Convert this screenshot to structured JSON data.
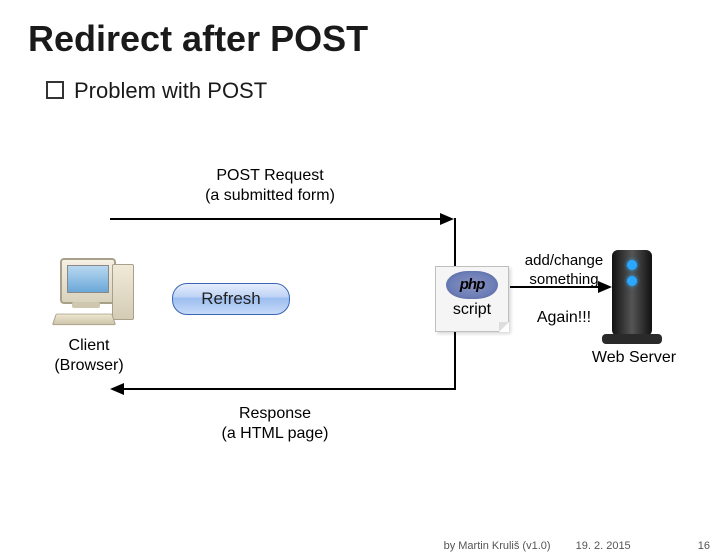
{
  "title": "Redirect after POST",
  "subtitle": "Problem with POST",
  "labels": {
    "post_request_line1": "POST Request",
    "post_request_line2": "(a submitted form)",
    "refresh": "Refresh",
    "php_logo": "php",
    "php_script": "script",
    "addchange_line1": "add/change",
    "addchange_line2": "something",
    "again": "Again!!!",
    "client_line1": "Client",
    "client_line2": "(Browser)",
    "webserver": "Web Server",
    "response_line1": "Response",
    "response_line2": "(a HTML page)"
  },
  "footer": {
    "author": "by Martin Kruliš (v1.0)",
    "date": "19. 2. 2015",
    "page": "16"
  }
}
